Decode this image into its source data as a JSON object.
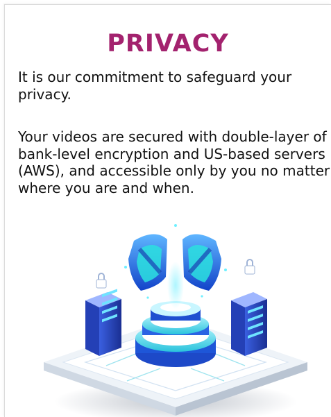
{
  "section": {
    "title": "PRIVACY",
    "paragraph_1": "It is our commitment to safeguard your privacy.",
    "paragraph_2": "Your videos are secured with double-layer of bank-level encryption and US-based servers (AWS), and accessible only by you no matter where you are and when."
  },
  "colors": {
    "title": "#a3226e",
    "text": "#111111",
    "accent_blue": "#1f6fd1",
    "accent_cyan": "#3fd7e6"
  },
  "illustration": {
    "icon": "secure-server-shield-illustration"
  }
}
